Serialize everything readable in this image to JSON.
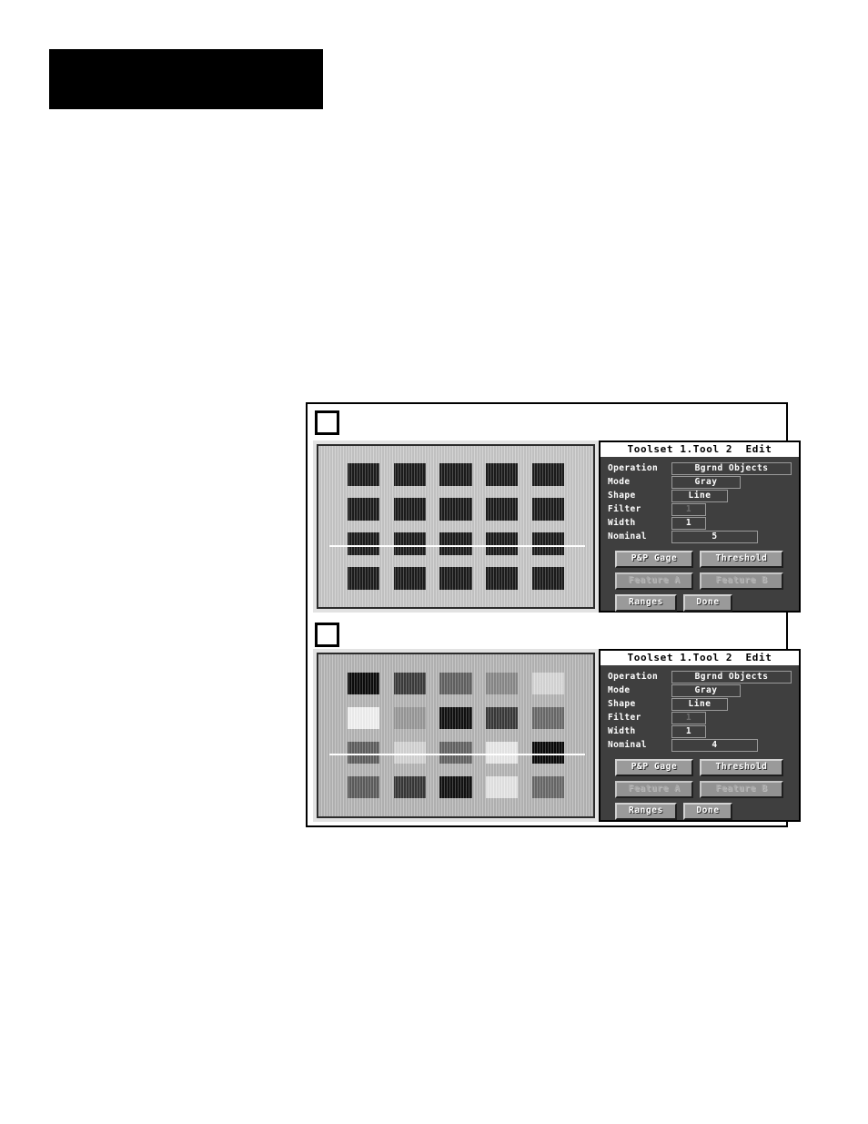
{
  "page": {
    "redacted_header_label": "redacted-black-block"
  },
  "figure": {
    "number_placeholder_1": "",
    "number_placeholder_2": ""
  },
  "panels": [
    {
      "id": "panel-top",
      "title": "Toolset 1.Tool 2  Edit",
      "fields": [
        {
          "label": "Operation",
          "value": "Bgrnd Objects",
          "dim": false,
          "width_class": "w-operation"
        },
        {
          "label": "Mode",
          "value": "Gray",
          "dim": false,
          "width_class": "w-mode"
        },
        {
          "label": "Shape",
          "value": "Line",
          "dim": false,
          "width_class": "w-shape"
        },
        {
          "label": "Filter",
          "value": "1",
          "dim": true,
          "width_class": "w-filter"
        },
        {
          "label": "Width",
          "value": "1",
          "dim": false,
          "width_class": "w-width"
        },
        {
          "label": "Nominal",
          "value": "5",
          "dim": false,
          "width_class": "w-nominal"
        }
      ],
      "buttons": [
        [
          {
            "label": "P&P Gage",
            "disabled": false,
            "width_class": "bw-pp"
          },
          {
            "label": "Threshold",
            "disabled": false,
            "width_class": "bw-thresh"
          }
        ],
        [
          {
            "label": "Feature A",
            "disabled": true,
            "width_class": "bw-feata"
          },
          {
            "label": "Feature B",
            "disabled": true,
            "width_class": "bw-featb"
          }
        ],
        [
          {
            "label": "Ranges",
            "disabled": false,
            "width_class": "bw-ranges"
          },
          {
            "label": "Done",
            "disabled": false,
            "width_class": "bw-done"
          }
        ]
      ],
      "image": {
        "background": "#c8c8c8",
        "scan_line_color": "#ffffff",
        "rows": 4,
        "cols": 5,
        "cell_colors": [
          [
            "#1c1c1c",
            "#1c1c1c",
            "#1c1c1c",
            "#1c1c1c",
            "#1c1c1c"
          ],
          [
            "#1c1c1c",
            "#1c1c1c",
            "#1c1c1c",
            "#1c1c1c",
            "#1c1c1c"
          ],
          [
            "#1c1c1c",
            "#1c1c1c",
            "#1c1c1c",
            "#1c1c1c",
            "#1c1c1c"
          ],
          [
            "#1c1c1c",
            "#1c1c1c",
            "#1c1c1c",
            "#1c1c1c",
            "#1c1c1c"
          ]
        ]
      }
    },
    {
      "id": "panel-bottom",
      "title": "Toolset 1.Tool 2  Edit",
      "fields": [
        {
          "label": "Operation",
          "value": "Bgrnd Objects",
          "dim": false,
          "width_class": "w-operation"
        },
        {
          "label": "Mode",
          "value": "Gray",
          "dim": false,
          "width_class": "w-mode"
        },
        {
          "label": "Shape",
          "value": "Line",
          "dim": false,
          "width_class": "w-shape"
        },
        {
          "label": "Filter",
          "value": "1",
          "dim": true,
          "width_class": "w-filter"
        },
        {
          "label": "Width",
          "value": "1",
          "dim": false,
          "width_class": "w-width"
        },
        {
          "label": "Nominal",
          "value": "4",
          "dim": false,
          "width_class": "w-nominal"
        }
      ],
      "buttons": [
        [
          {
            "label": "P&P Gage",
            "disabled": false,
            "width_class": "bw-pp"
          },
          {
            "label": "Threshold",
            "disabled": false,
            "width_class": "bw-thresh"
          }
        ],
        [
          {
            "label": "Feature A",
            "disabled": true,
            "width_class": "bw-feata"
          },
          {
            "label": "Feature B",
            "disabled": true,
            "width_class": "bw-featb"
          }
        ],
        [
          {
            "label": "Ranges",
            "disabled": false,
            "width_class": "bw-ranges"
          },
          {
            "label": "Done",
            "disabled": false,
            "width_class": "bw-done"
          }
        ]
      ],
      "image": {
        "background": "#b6b6b6",
        "scan_line_color": "#ffffff",
        "rows": 4,
        "cols": 5,
        "cell_colors": [
          [
            "#0d0d0d",
            "#3c3c3c",
            "#636363",
            "#8a8a8a",
            "#d8d8d8"
          ],
          [
            "#f2f2f2",
            "#9a9a9a",
            "#111111",
            "#3a3a3a",
            "#6b6b6b"
          ],
          [
            "#606060",
            "#d5d5d5",
            "#656565",
            "#eaeaea",
            "#0a0a0a"
          ],
          [
            "#5e5e5e",
            "#383838",
            "#121212",
            "#e6e6e6",
            "#6a6a6a"
          ]
        ]
      }
    }
  ]
}
